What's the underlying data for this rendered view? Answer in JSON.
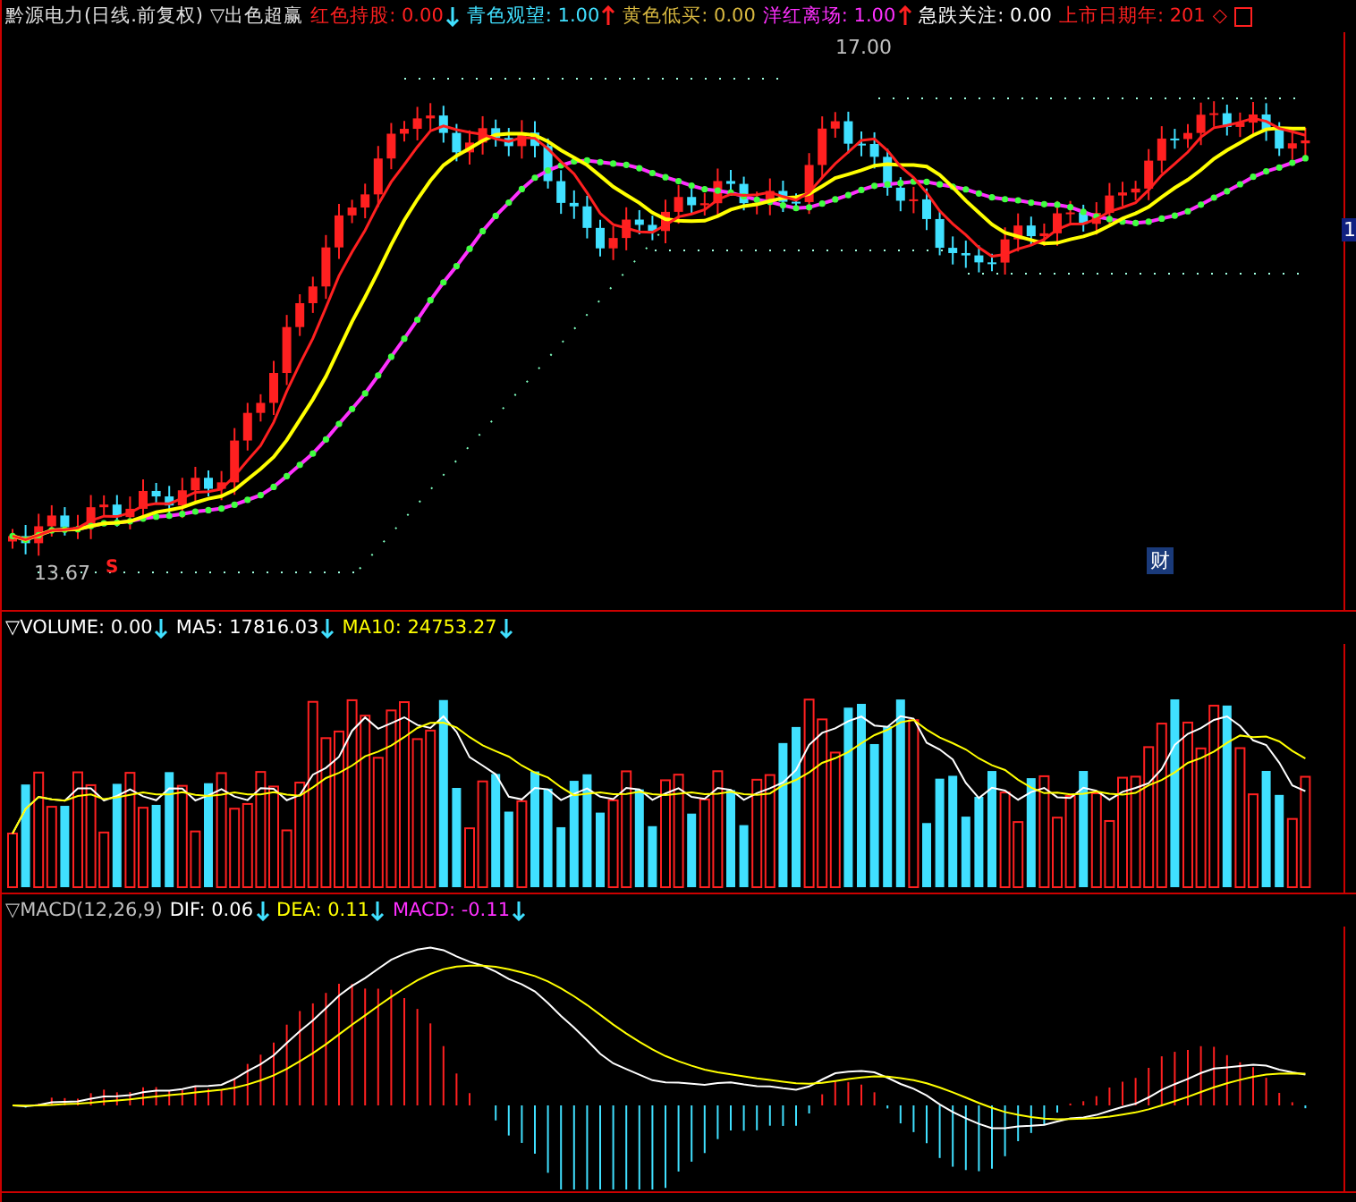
{
  "main_header": {
    "stock": "黔源电力(日线.前复权)",
    "formula": "▽出色超赢",
    "indicators": [
      {
        "label": "红色持股:",
        "value": "0.00",
        "rising": false,
        "color": "#ff2020"
      },
      {
        "label": "青色观望:",
        "value": "1.00",
        "rising": true,
        "color": "#40e0ff"
      },
      {
        "label": "黄色低买:",
        "value": "0.00",
        "color": "#d8b840"
      },
      {
        "label": "洋红离场:",
        "value": "1.00",
        "rising": true,
        "color": "#ff30ff"
      },
      {
        "label": "急跌关注:",
        "value": "0.00",
        "color": "#ffffff"
      },
      {
        "label": "上市日期年:",
        "value": "201",
        "color": "#ff2020"
      }
    ],
    "diamond": "◇"
  },
  "price_chart": {
    "high_marker": "17.00",
    "low_marker": "13.67",
    "signal": "S",
    "badge": "财",
    "price_tag": "1"
  },
  "volume_header": [
    {
      "label": "▽VOLUME:",
      "value": "0.00",
      "rising": false,
      "color": "#ffffff"
    },
    {
      "label": "MA5:",
      "value": "17816.03",
      "rising": false,
      "color": "#ffffff"
    },
    {
      "label": "MA10:",
      "value": "24753.27",
      "rising": false,
      "color": "#ffff00"
    }
  ],
  "macd_header": [
    {
      "label": "▽MACD(12,26,9)",
      "color": "#c0c0c0"
    },
    {
      "label": "DIF:",
      "value": "0.06",
      "rising": false,
      "color": "#ffffff"
    },
    {
      "label": "DEA:",
      "value": "0.11",
      "rising": false,
      "color": "#ffff00"
    },
    {
      "label": "MACD:",
      "value": "-0.11",
      "rising": false,
      "color": "#ff30ff"
    }
  ]
}
